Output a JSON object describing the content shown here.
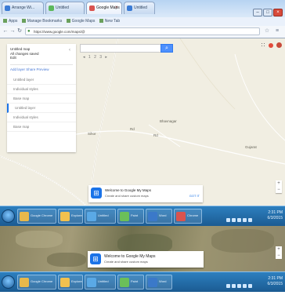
{
  "browser": {
    "tabs": [
      {
        "label": "Arrange Wi...",
        "favicon_color": "#3a7bd5",
        "active": false
      },
      {
        "label": "Untitled",
        "favicon_color": "#5cb85c",
        "active": false
      },
      {
        "label": "Google Maps",
        "favicon_color": "#d9534f",
        "active": true
      },
      {
        "label": "Untitled",
        "favicon_color": "#3a7bd5",
        "active": false
      }
    ],
    "window_buttons": {
      "minimize": "–",
      "maximize": "□",
      "close": "×"
    },
    "bookmarks": [
      "Apps",
      "Manage Bookmarks",
      "Google Maps",
      "New Tab"
    ],
    "address": "https://www.google.com/maps/@",
    "back_glyph": "←",
    "forward_glyph": "→",
    "reload_glyph": "↻",
    "star_glyph": "☆",
    "menu_glyph": "≡"
  },
  "map": {
    "search": {
      "placeholder": "",
      "value": "",
      "button_glyph": "🔍"
    },
    "toolbar": [
      "◂",
      "1",
      "2",
      "3",
      "▸"
    ],
    "sidebar": {
      "header_line1": "Untitled map",
      "header_line2": "All changes saved",
      "header_line3": "Edit",
      "collapse_glyph": "‹",
      "menu_label": "Add layer  Share  Preview",
      "items": [
        {
          "label": "Untitled layer",
          "active": false
        },
        {
          "label": "Individual styles",
          "active": false
        },
        {
          "label": "Base map",
          "active": false
        },
        {
          "label": "Untitled layer",
          "active": true
        },
        {
          "label": "Individual styles",
          "active": false
        },
        {
          "label": "Base map",
          "active": false
        }
      ]
    },
    "labels": [
      {
        "text": "Bhavnagar"
      },
      {
        "text": "Rd"
      },
      {
        "text": "Rd"
      },
      {
        "text": "Sihor"
      },
      {
        "text": "Gujarat"
      }
    ],
    "top_controls": {
      "apps_icon": "apps-icon",
      "notifications_icon": "bell-icon",
      "avatar_icon": "avatar"
    },
    "info_card": {
      "icon_glyph": "⊞",
      "title": "Welcome to Google My Maps",
      "body": "Create and share custom maps",
      "link": "GOT IT"
    },
    "zoom": {
      "in": "+",
      "out": "−"
    }
  },
  "taskbar": {
    "buttons": [
      {
        "label": "Google Chrome",
        "thumb_color": "#e7b84b"
      },
      {
        "label": "Explorer",
        "thumb_color": "#f2c14e"
      },
      {
        "label": "Untitled",
        "thumb_color": "#5aa9e6"
      },
      {
        "label": "Paint",
        "thumb_color": "#6bbf59"
      },
      {
        "label": "Word",
        "thumb_color": "#3b79c9"
      },
      {
        "label": "Chrome",
        "thumb_color": "#d9534f"
      }
    ],
    "time": "2:31 PM",
    "date": "6/3/2015"
  },
  "satellite_view": {
    "info_card": {
      "icon_glyph": "⊞",
      "title": "Welcome to Google My Maps",
      "body": "Create and share custom maps"
    },
    "zoom": {
      "in": "+",
      "out": "−"
    }
  },
  "colors": {
    "accent": "#1a73e8",
    "map_background": "#f1eee2",
    "taskbar": "#1b5b92"
  }
}
